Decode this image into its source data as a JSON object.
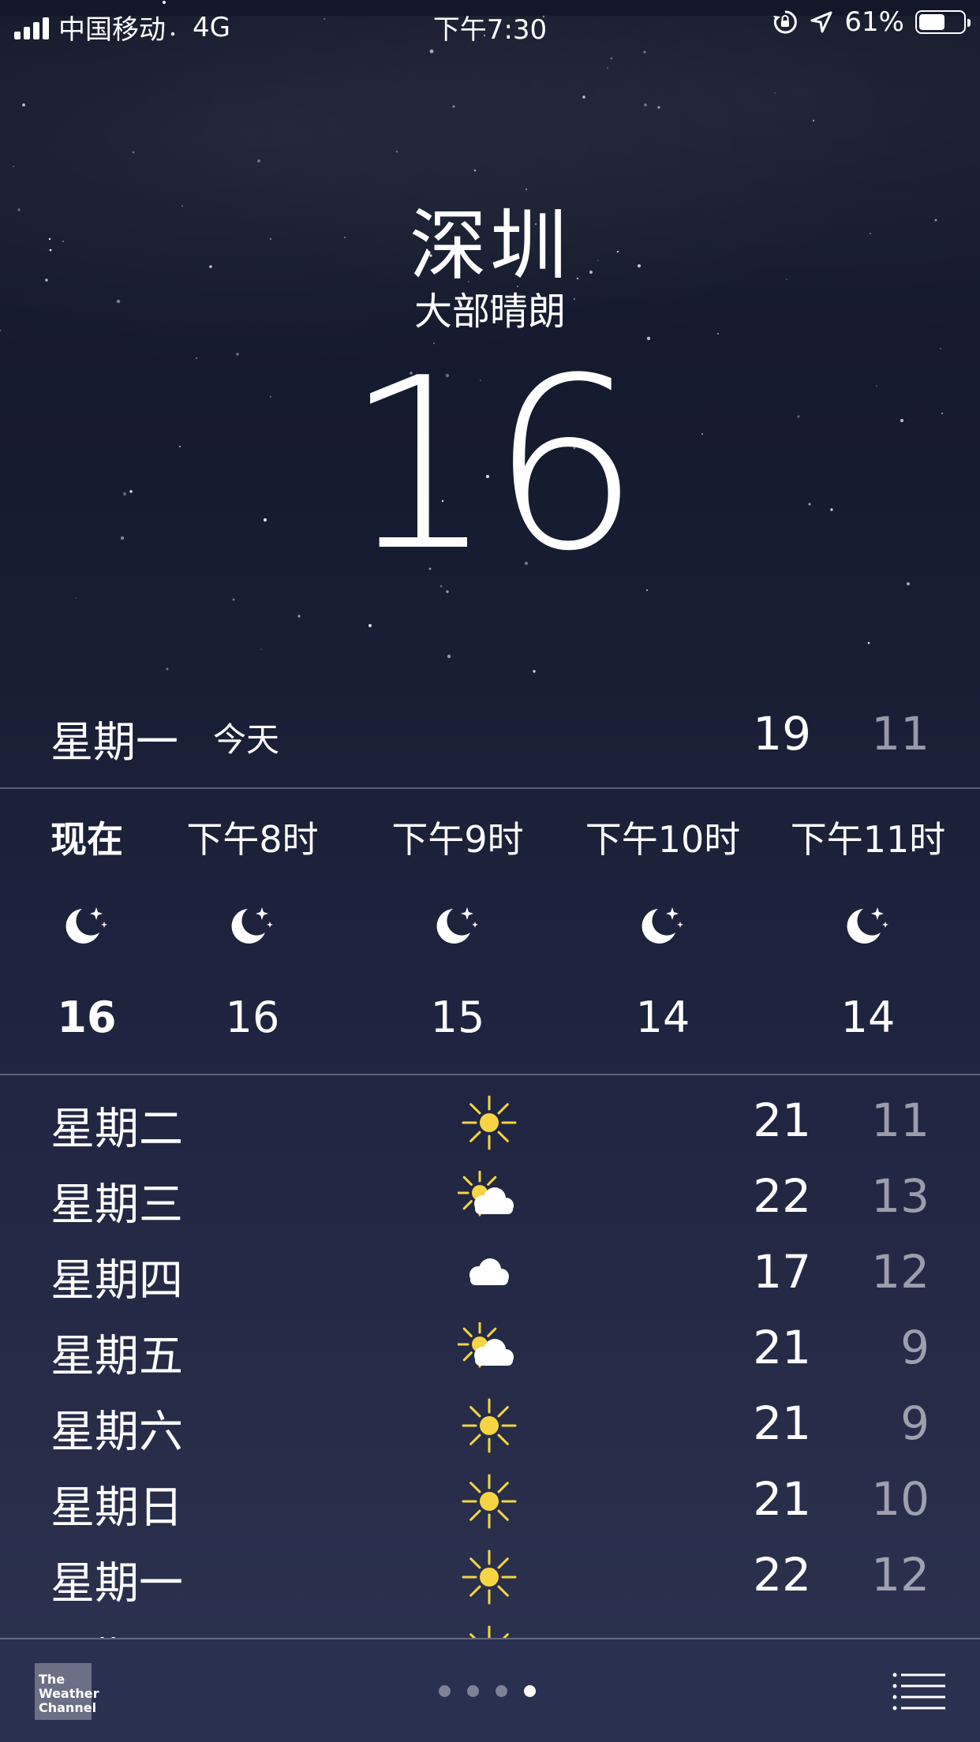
{
  "status_bar": {
    "carrier": "中国移动",
    "network": "4G",
    "time": "下午7:30",
    "battery_percent": "61%",
    "battery_level": 0.61
  },
  "location": {
    "city": "深圳",
    "condition": "大部晴朗",
    "current_temp": "16"
  },
  "today": {
    "day": "星期一",
    "label": "今天",
    "high": "19",
    "low": "11"
  },
  "hourly": [
    {
      "time": "现在",
      "icon": "moon-stars-icon",
      "temp": "16"
    },
    {
      "time": "下午8时",
      "icon": "moon-stars-icon",
      "temp": "16"
    },
    {
      "time": "下午9时",
      "icon": "moon-stars-icon",
      "temp": "15"
    },
    {
      "time": "下午10时",
      "icon": "moon-stars-icon",
      "temp": "14"
    },
    {
      "time": "下午11时",
      "icon": "moon-stars-icon",
      "temp": "14"
    }
  ],
  "daily": [
    {
      "day": "星期二",
      "icon": "sun-icon",
      "high": "21",
      "low": "11"
    },
    {
      "day": "星期三",
      "icon": "partly-cloudy-icon",
      "high": "22",
      "low": "13"
    },
    {
      "day": "星期四",
      "icon": "cloud-icon",
      "high": "17",
      "low": "12"
    },
    {
      "day": "星期五",
      "icon": "partly-cloudy-icon",
      "high": "21",
      "low": "9"
    },
    {
      "day": "星期六",
      "icon": "sun-icon",
      "high": "21",
      "low": "9"
    },
    {
      "day": "星期日",
      "icon": "sun-icon",
      "high": "21",
      "low": "10"
    },
    {
      "day": "星期一",
      "icon": "sun-icon",
      "high": "22",
      "low": "12"
    },
    {
      "day": "星期二",
      "icon": "sun-icon",
      "high": "",
      "low": ""
    }
  ],
  "bottom_bar": {
    "logo_text": [
      "The",
      "Weather",
      "Channel"
    ],
    "page_count": 4,
    "active_page": 4
  },
  "colors": {
    "sun": "#f6d443",
    "cloud": "#ffffff",
    "low_temp": "#9a9eb0",
    "bottom_bar": "#2a3050"
  }
}
